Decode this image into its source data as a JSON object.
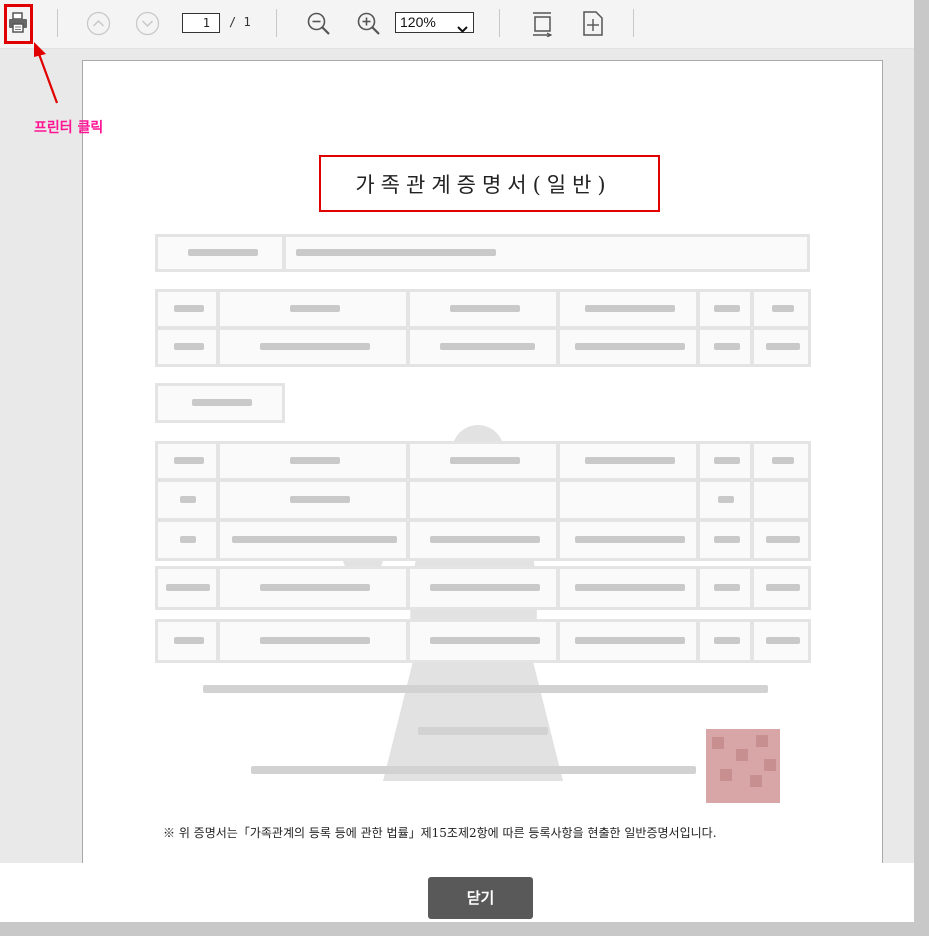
{
  "toolbar": {
    "page_current": "1",
    "page_total": "/ 1",
    "zoom_value": "120%",
    "icons": [
      "printer-icon",
      "prev-page-icon",
      "next-page-icon",
      "zoom-out-icon",
      "zoom-in-icon",
      "fit-page-icon",
      "fit-width-icon"
    ]
  },
  "annotation": {
    "label": "프린터 클릭",
    "color": "#ff1493",
    "highlight_color": "#e00000"
  },
  "document": {
    "title": "가족관계증명서(일반)",
    "footnote": "※ 위 증명서는「가족관계의 등록 등에 관한 법률」제15조제2항에 따른 등록사항을 현출한 일반증명서입니다."
  },
  "footer": {
    "close_label": "닫기"
  },
  "colors": {
    "button_bg": "#595959",
    "toolbar_bg": "#f4f4f4",
    "viewer_bg": "#e9e9e9"
  }
}
